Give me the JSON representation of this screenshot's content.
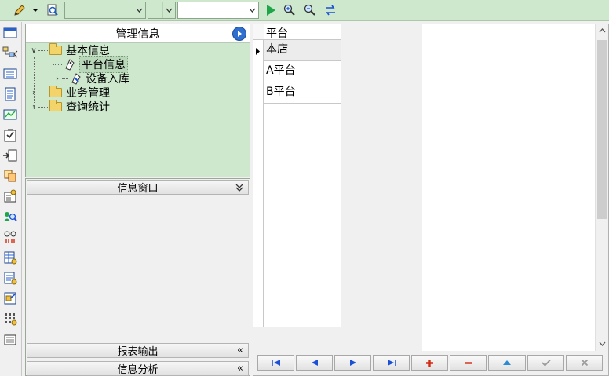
{
  "toolbar": {
    "combo1_value": "",
    "combo2_value": "",
    "combo3_value": ""
  },
  "nav": {
    "title": "管理信息",
    "tree": [
      {
        "label": "基本信息",
        "expanded": true
      },
      {
        "label": "平台信息",
        "selected": true
      },
      {
        "label": "设备入库"
      },
      {
        "label": "业务管理"
      },
      {
        "label": "查询统计"
      }
    ]
  },
  "info": {
    "title": "信息窗口",
    "report_bar": "报表输出",
    "analysis_bar": "信息分析"
  },
  "grid": {
    "header": "平台",
    "rows": [
      "本店",
      "A平台",
      "B平台"
    ]
  },
  "colors": {
    "toolbar_bg": "#cde8cd",
    "accent_green": "#1fa64a",
    "nav_blue": "#1a4fd6",
    "danger_red": "#d32a10"
  }
}
